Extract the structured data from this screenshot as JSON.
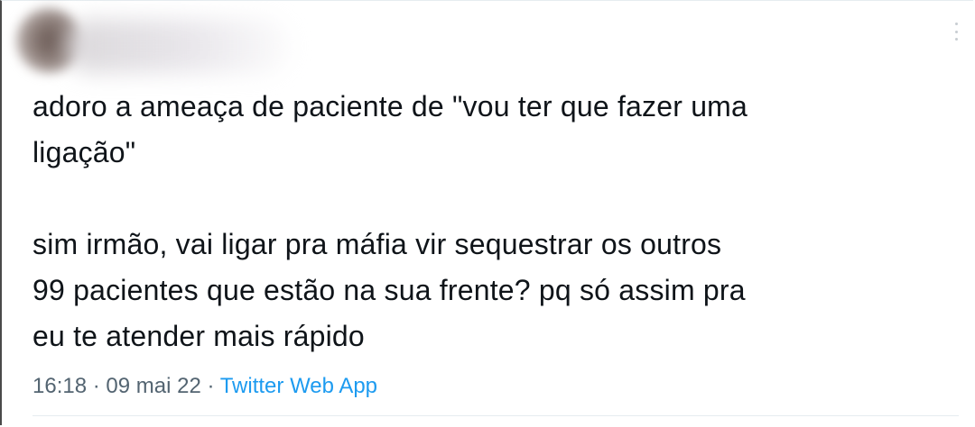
{
  "tweet": {
    "paragraphs": [
      "adoro a ameaça de paciente de \"vou ter que fazer uma\nligação\"",
      "sim irmão, vai ligar pra máfia vir sequestrar os outros\n99 pacientes que estão na sua frente? pq só assim pra\neu te atender mais rápido"
    ],
    "time": "16:18",
    "separator": "·",
    "date": "09 mai 22",
    "source": "Twitter Web App"
  },
  "icons": {
    "more": "more-vertical-icon"
  },
  "colors": {
    "text": "#0f1419",
    "meta": "#536471",
    "link": "#1d9bf0"
  }
}
